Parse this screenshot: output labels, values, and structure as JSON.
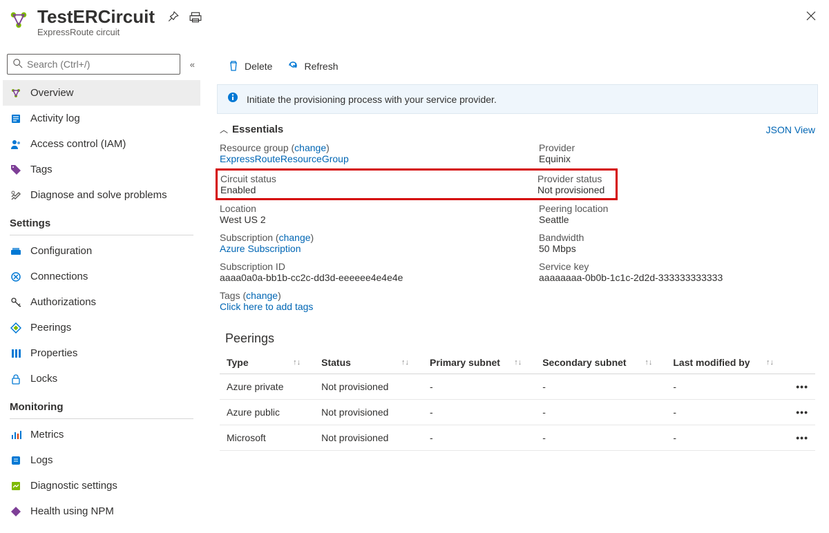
{
  "header": {
    "title": "TestERCircuit",
    "subtitle": "ExpressRoute circuit"
  },
  "search": {
    "placeholder": "Search (Ctrl+/)"
  },
  "sidebar": {
    "top_items": [
      {
        "label": "Overview"
      },
      {
        "label": "Activity log"
      },
      {
        "label": "Access control (IAM)"
      },
      {
        "label": "Tags"
      },
      {
        "label": "Diagnose and solve problems"
      }
    ],
    "settings_header": "Settings",
    "settings_items": [
      {
        "label": "Configuration"
      },
      {
        "label": "Connections"
      },
      {
        "label": "Authorizations"
      },
      {
        "label": "Peerings"
      },
      {
        "label": "Properties"
      },
      {
        "label": "Locks"
      }
    ],
    "monitoring_header": "Monitoring",
    "monitoring_items": [
      {
        "label": "Metrics"
      },
      {
        "label": "Logs"
      },
      {
        "label": "Diagnostic settings"
      },
      {
        "label": "Health using NPM"
      }
    ]
  },
  "toolbar": {
    "delete_label": "Delete",
    "refresh_label": "Refresh"
  },
  "banner": {
    "text": "Initiate the provisioning process with your service provider."
  },
  "essentials": {
    "header": "Essentials",
    "json_view": "JSON View",
    "change": "change",
    "left": {
      "resource_group_label": "Resource group (",
      "resource_group_value": "ExpressRouteResourceGroup",
      "circuit_status_label": "Circuit status",
      "circuit_status_value": "Enabled",
      "location_label": "Location",
      "location_value": "West US 2",
      "subscription_label": "Subscription (",
      "subscription_value": "Azure Subscription",
      "subscription_id_label": "Subscription ID",
      "subscription_id_value": "aaaa0a0a-bb1b-cc2c-dd3d-eeeeee4e4e4e",
      "tags_label": "Tags (",
      "tags_value": "Click here to add tags"
    },
    "right": {
      "provider_label": "Provider",
      "provider_value": "Equinix",
      "provider_status_label": "Provider status",
      "provider_status_value": "Not provisioned",
      "peering_location_label": "Peering location",
      "peering_location_value": "Seattle",
      "bandwidth_label": "Bandwidth",
      "bandwidth_value": "50 Mbps",
      "service_key_label": "Service key",
      "service_key_value": "aaaaaaaa-0b0b-1c1c-2d2d-333333333333"
    }
  },
  "paren_close": ")",
  "peerings": {
    "title": "Peerings",
    "columns": [
      "Type",
      "Status",
      "Primary subnet",
      "Secondary subnet",
      "Last modified by"
    ],
    "rows": [
      {
        "type": "Azure private",
        "status": "Not provisioned",
        "primary": "-",
        "secondary": "-",
        "modified": "-"
      },
      {
        "type": "Azure public",
        "status": "Not provisioned",
        "primary": "-",
        "secondary": "-",
        "modified": "-"
      },
      {
        "type": "Microsoft",
        "status": "Not provisioned",
        "primary": "-",
        "secondary": "-",
        "modified": "-"
      }
    ]
  }
}
